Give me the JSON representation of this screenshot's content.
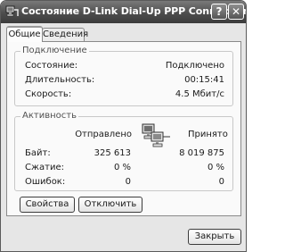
{
  "window": {
    "title": "Состояние D-Link Dial-Up PPP Connection",
    "help_label": "?",
    "close_label": "✕"
  },
  "tabs": [
    {
      "label": "Общие",
      "active": true
    },
    {
      "label": "Сведения",
      "active": false
    }
  ],
  "connection": {
    "legend": "Подключение",
    "rows": [
      {
        "label": "Состояние:",
        "value": "Подключено"
      },
      {
        "label": "Длительность:",
        "value": "00:15:41"
      },
      {
        "label": "Скорость:",
        "value": "4.5 Мбит/с"
      }
    ]
  },
  "activity": {
    "legend": "Активность",
    "sent_header": "Отправлено",
    "received_header": "Принято",
    "rows": [
      {
        "label": "Байт:",
        "sent": "325 613",
        "received": "8 019 875"
      },
      {
        "label": "Сжатие:",
        "sent": "0 %",
        "received": "0 %"
      },
      {
        "label": "Ошибок:",
        "sent": "0",
        "received": "0"
      }
    ],
    "icon": "network-activity-icon"
  },
  "buttons": {
    "properties": "Свойства",
    "disconnect": "Отключить",
    "close": "Закрыть"
  },
  "colors": {
    "titlebar": "#4d4d4d",
    "panel": "#fafafa",
    "window": "#e6e6e6"
  }
}
